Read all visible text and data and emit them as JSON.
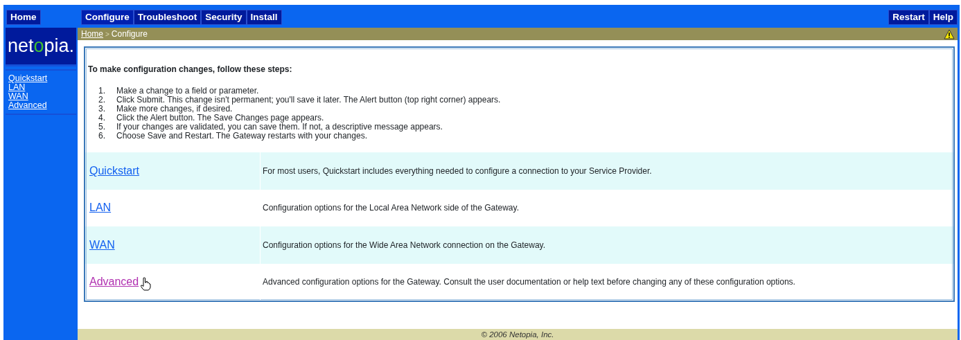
{
  "top_nav": {
    "left": [
      {
        "label": "Home",
        "selected": false
      }
    ],
    "main": [
      {
        "label": "Configure",
        "selected": true
      },
      {
        "label": "Troubleshoot",
        "selected": false
      },
      {
        "label": "Security",
        "selected": false
      },
      {
        "label": "Install",
        "selected": false
      }
    ],
    "right": [
      {
        "label": "Restart",
        "selected": false
      },
      {
        "label": "Help",
        "selected": false
      }
    ]
  },
  "sidebar": {
    "logo": "netopia.",
    "items": [
      {
        "label": "Quickstart"
      },
      {
        "label": "LAN"
      },
      {
        "label": "WAN"
      },
      {
        "label": "Advanced"
      }
    ]
  },
  "breadcrumb": {
    "items": [
      "Home",
      "Configure"
    ],
    "separator": ">",
    "alert": true
  },
  "intro": {
    "heading": "To make configuration changes, follow these steps:",
    "steps": [
      {
        "number": "1.",
        "text": "Make a change to a field or parameter."
      },
      {
        "number": "2.",
        "text": "Click Submit. This change isn't permanent; you'll save it later. The Alert button (top right corner) appears."
      },
      {
        "number": "3.",
        "text": "Make more changes, if desired."
      },
      {
        "number": "4.",
        "text": "Click the Alert button. The Save Changes page appears."
      },
      {
        "number": "5.",
        "text": "If your changes are validated, you can save them. If not, a descriptive message appears."
      },
      {
        "number": "6.",
        "text": "Choose Save and Restart. The Gateway restarts with your changes."
      }
    ]
  },
  "sections": [
    {
      "link": "Quickstart",
      "description": "For most users, Quickstart includes everything needed to configure a connection to your Service Provider.",
      "visited": false,
      "hovered": false
    },
    {
      "link": "LAN",
      "description": "Configuration options for the Local Area Network side of the Gateway.",
      "visited": false,
      "hovered": false
    },
    {
      "link": "WAN",
      "description": "Configuration options for the Wide Area Network connection on the Gateway.",
      "visited": false,
      "hovered": false
    },
    {
      "link": "Advanced",
      "description": "Advanced configuration options for the Gateway. Consult the user documentation or help text before changing any of these configuration options.",
      "visited": true,
      "hovered": true
    }
  ],
  "footer": "© 2006 Netopia, Inc."
}
